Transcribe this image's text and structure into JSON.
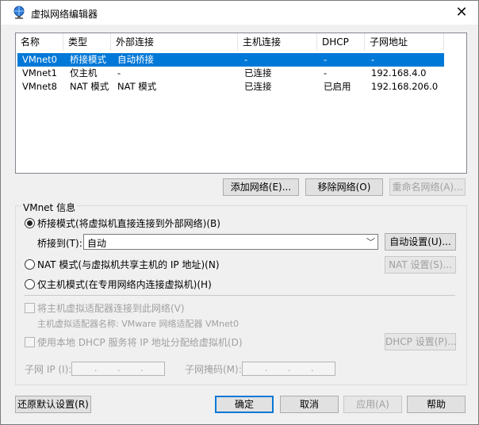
{
  "window": {
    "title": "虚拟网络编辑器",
    "close": "✕"
  },
  "table": {
    "headers": [
      "名称",
      "类型",
      "外部连接",
      "主机连接",
      "DHCP",
      "子网地址"
    ],
    "rows": [
      {
        "name": "VMnet0",
        "type": "桥接模式",
        "external": "自动桥接",
        "host": "-",
        "dhcp": "-",
        "subnet": "-",
        "selected": true
      },
      {
        "name": "VMnet1",
        "type": "仅主机",
        "external": "-",
        "host": "已连接",
        "dhcp": "-",
        "subnet": "192.168.4.0",
        "selected": false
      },
      {
        "name": "VMnet8",
        "type": "NAT 模式",
        "external": "NAT 模式",
        "host": "已连接",
        "dhcp": "已启用",
        "subnet": "192.168.206.0",
        "selected": false
      }
    ]
  },
  "list_buttons": {
    "add": "添加网络(E)...",
    "remove": "移除网络(O)",
    "rename": "重命名网络(A)..."
  },
  "vmnet_info": {
    "label": "VMnet 信息",
    "bridged_radio": "桥接模式(将虚拟机直接连接到外部网络)(B)",
    "bridged_to_label": "桥接到(T):",
    "bridged_to_value": "自动",
    "auto_settings": "自动设置(U)...",
    "nat_radio": "NAT 模式(与虚拟机共享主机的 IP 地址)(N)",
    "nat_settings": "NAT 设置(S)...",
    "hostonly_radio": "仅主机模式(在专用网络内连接虚拟机)(H)",
    "connect_adapter_check": "将主机虚拟适配器连接到此网络(V)",
    "adapter_name": "主机虚拟适配器名称: VMware 网络适配器 VMnet0",
    "dhcp_check": "使用本地 DHCP 服务将 IP 地址分配给虚拟机(D)",
    "dhcp_settings": "DHCP 设置(P)...",
    "subnet_ip_label": "子网 IP (I):",
    "subnet_mask_label": "子网掩码(M):",
    "ip_dots": "."
  },
  "footer": {
    "restore": "还原默认设置(R)",
    "ok": "确定",
    "cancel": "取消",
    "apply": "应用(A)",
    "help": "帮助"
  }
}
